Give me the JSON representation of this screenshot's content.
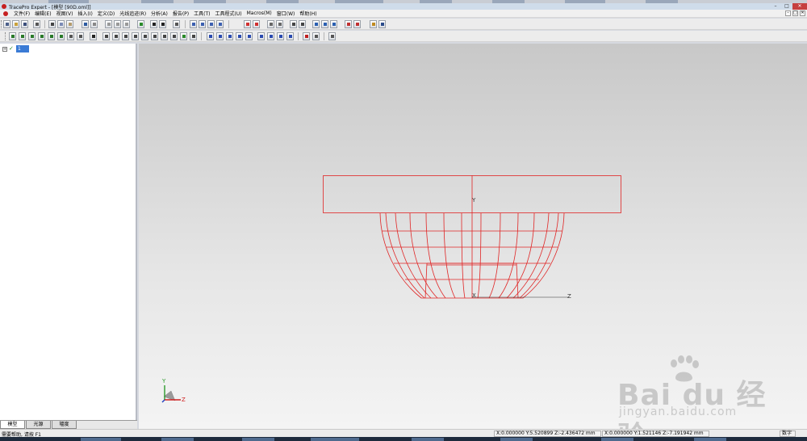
{
  "window": {
    "title": "TracePro Expert - [模型 [90D.oml]]",
    "controls": [
      "–",
      "□",
      "✕"
    ]
  },
  "menubar": {
    "items": [
      "文件(F)",
      "编辑(E)",
      "视图(V)",
      "插入(I)",
      "定义(D)",
      "光线追迹(R)",
      "分析(A)",
      "报告(P)",
      "工具(T)",
      "工具程式(U)",
      "Macros(M)",
      "窗口(W)",
      "帮助(H)"
    ],
    "mdi_controls": [
      "–",
      "□",
      "✕"
    ]
  },
  "tree": {
    "node_label": "1",
    "expander": "+",
    "check": "✓",
    "tabs": [
      "模型",
      "光源",
      "辐度"
    ]
  },
  "viewport": {
    "axis_labels": {
      "y": "Y",
      "x": "X",
      "z": "Z"
    },
    "triad_labels": {
      "y": "Y",
      "z": "Z"
    },
    "wireframe_color": "#e02424"
  },
  "watermark": {
    "brand": "Bai du 经验",
    "url": "jingyan.baidu.com"
  },
  "statusbar": {
    "help": "需要帮助, 请按 F1",
    "coord1": "X:0.000000 Y:5.520899 Z:-2.436472 mm",
    "coord2": "X:0.000000 Y:1.521146 Z:-7.191942 mm",
    "mode": "数字"
  }
}
